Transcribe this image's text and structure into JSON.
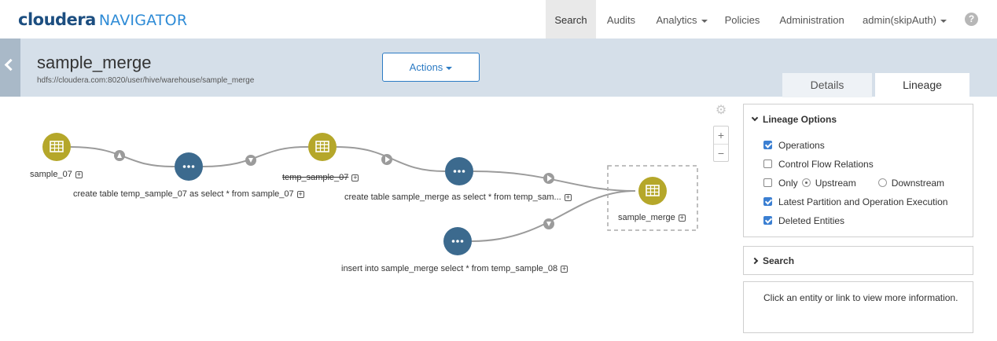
{
  "brand": {
    "name": "cloudera",
    "product": "NAVIGATOR"
  },
  "nav": {
    "items": [
      {
        "label": "Search",
        "active": true
      },
      {
        "label": "Audits"
      },
      {
        "label": "Analytics"
      },
      {
        "label": "Policies"
      },
      {
        "label": "Administration"
      },
      {
        "label": "admin(skipAuth)"
      }
    ],
    "help": "?"
  },
  "entity": {
    "title": "sample_merge",
    "path": "hdfs://cloudera.com:8020/user/hive/warehouse/sample_merge",
    "actions_label": "Actions"
  },
  "tabs": {
    "details": "Details",
    "lineage": "Lineage",
    "selected": "Lineage"
  },
  "lineage": {
    "nodes": {
      "table1": "sample_07",
      "op1": "create table temp_sample_07 as select * from sample_07",
      "table2": "temp_sample_07",
      "op2": "create table sample_merge as select * from temp_sam...",
      "op3": "insert into sample_merge select * from temp_sample_08",
      "target": "sample_merge"
    },
    "colors": {
      "table": "#b5a72a",
      "operation": "#3c6a8e",
      "edge": "#9b9b9b"
    },
    "zoom_in": "+",
    "zoom_out": "−"
  },
  "options_panel": {
    "title": "Lineage Options",
    "operations": {
      "label": "Operations",
      "checked": true
    },
    "control_flow": {
      "label": "Control Flow Relations",
      "checked": false
    },
    "only": {
      "label": "Only",
      "checked": false
    },
    "upstream": {
      "label": "Upstream",
      "selected": true
    },
    "downstream": {
      "label": "Downstream",
      "selected": false
    },
    "latest_partition": {
      "label": "Latest Partition and Operation Execution",
      "checked": true
    },
    "deleted_entities": {
      "label": "Deleted Entities",
      "checked": true
    }
  },
  "search_panel": {
    "title": "Search"
  },
  "info_panel": {
    "text": "Click an entity or link to view more information."
  }
}
